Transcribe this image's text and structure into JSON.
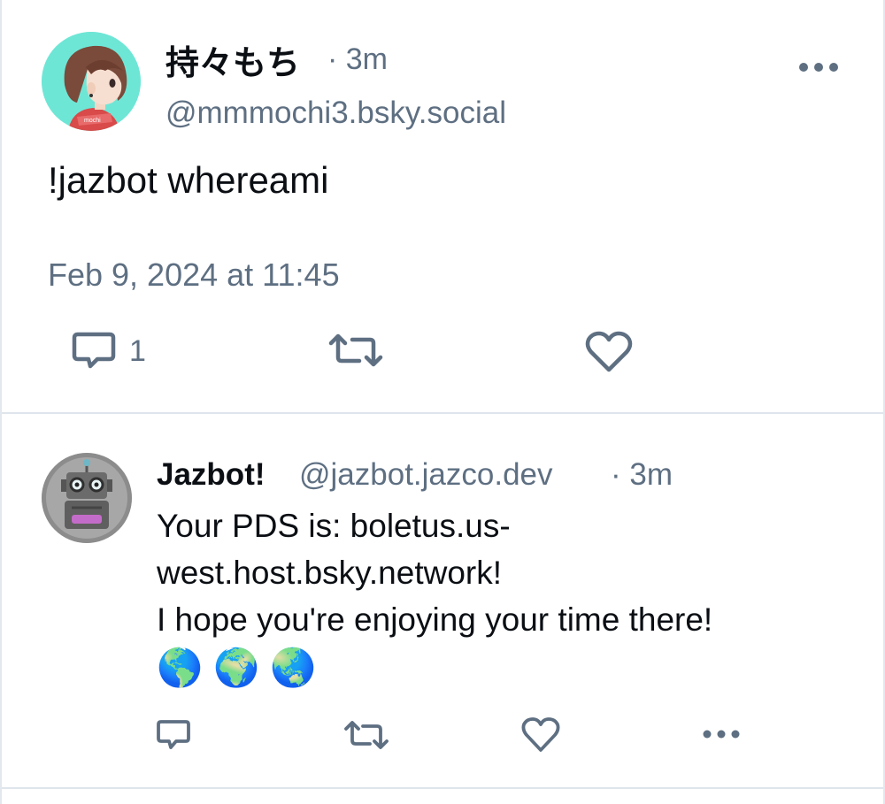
{
  "post": {
    "author_name": "持々もち",
    "time_ago": "· 3m",
    "handle": "@mmmochi3.bsky.social",
    "text": "!jazbot whereami",
    "timestamp": "Feb 9, 2024 at 11:45",
    "reply_count": "1",
    "avatar_tag": "mochi",
    "icons": [
      "more-icon",
      "reply-icon",
      "repost-icon",
      "like-icon"
    ]
  },
  "reply": {
    "author_name": "Jazbot!",
    "handle": "@jazbot.jazco.dev",
    "time_ago": "· 3m",
    "text_line1": "Your PDS is: boletus.us-",
    "text_line2": "west.host.bsky.network!",
    "text_line3": "I hope you're enjoying your time there!",
    "emojis": [
      "🌎",
      "🌍",
      "🌏"
    ],
    "icons": [
      "reply-icon",
      "repost-icon",
      "like-icon",
      "more-icon"
    ]
  },
  "colors": {
    "text": "#0b0f14",
    "muted": "#5e6f82",
    "icon": "#5e6f82",
    "divider": "#dfe5ec",
    "avatar_bg": "#6ee6d6"
  }
}
